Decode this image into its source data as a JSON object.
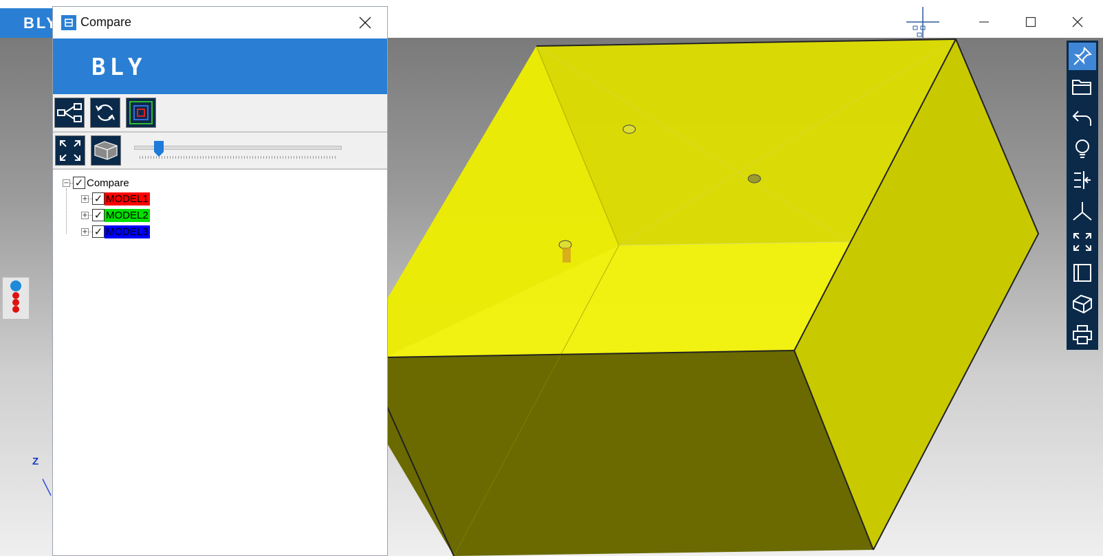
{
  "app": {
    "logo_text": "BLY",
    "window_controls": [
      "minimize",
      "maximize",
      "close"
    ]
  },
  "dialog": {
    "title": "Compare",
    "banner_logo": "BLY",
    "toolbar1_icons": [
      "tree-share-icon",
      "refresh-icon",
      "layers-frame-icon"
    ],
    "toolbar2_icons": [
      "fit-view-icon",
      "box-section-icon"
    ],
    "slider": {
      "value_fraction": 0.12
    },
    "tree": {
      "root_label": "Compare",
      "items": [
        {
          "label": "MODEL1",
          "color": "#ff0000",
          "checked": true
        },
        {
          "label": "MODEL2",
          "color": "#00e000",
          "checked": true
        },
        {
          "label": "MODEL3",
          "color": "#0000ff",
          "checked": true
        }
      ]
    }
  },
  "viewport": {
    "model_color": "#ffff00",
    "axis_label": "Z"
  },
  "right_toolbar": {
    "icons": [
      "pin-icon",
      "open-folder-icon",
      "undo-icon",
      "lightbulb-icon",
      "align-icon",
      "axes-icon",
      "fit-view-icon",
      "square-view-icon",
      "cube-view-icon",
      "print-icon"
    ]
  }
}
